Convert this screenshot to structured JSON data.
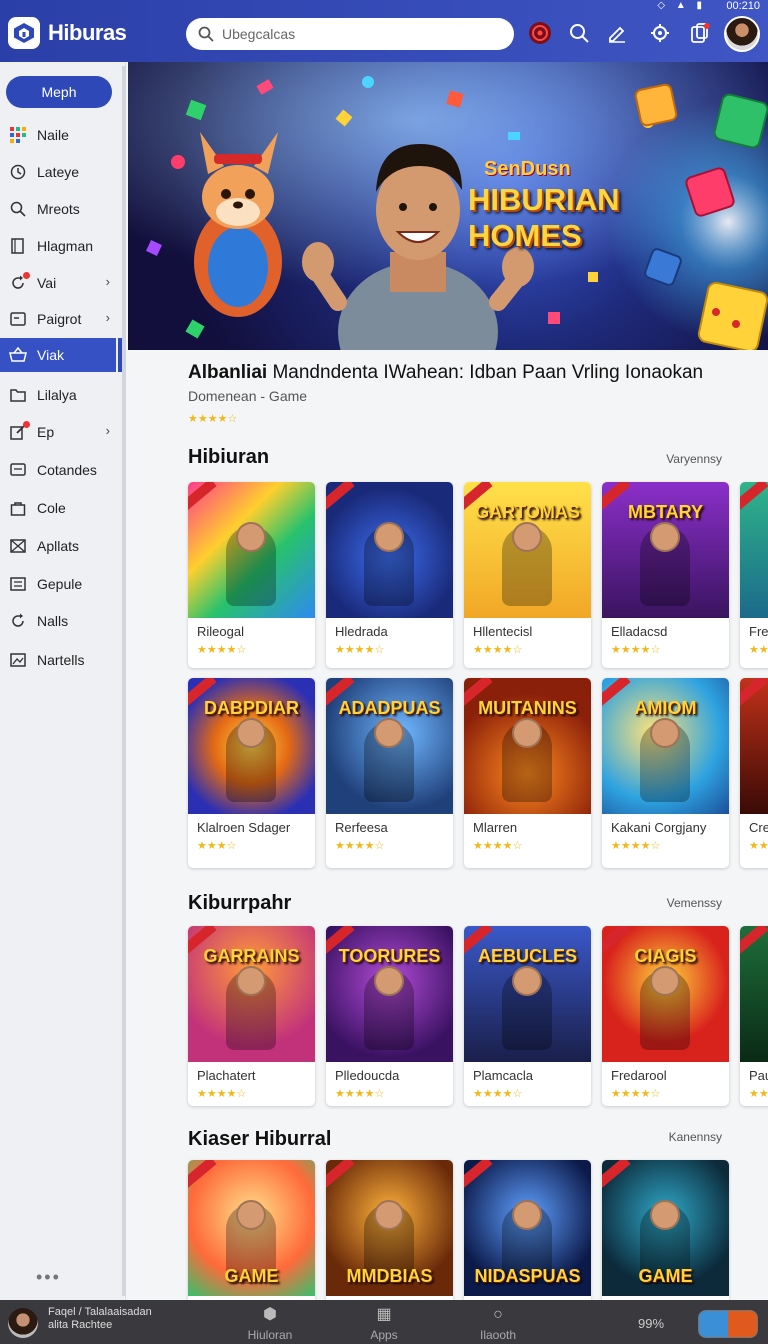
{
  "status": {
    "time": "00:210",
    "icons": "◇ ▲ ▮"
  },
  "header": {
    "app_title": "Hiburas",
    "search_placeholder": "Ubegcalcas"
  },
  "sidebar": {
    "primary_button": "Meph",
    "items": [
      {
        "label": "Naile",
        "icon": "grid-icon",
        "chevron": false,
        "badge": false
      },
      {
        "label": "Lateye",
        "icon": "clock-icon",
        "chevron": false,
        "badge": false
      },
      {
        "label": "Mreots",
        "icon": "search-icon",
        "chevron": false,
        "badge": false
      },
      {
        "label": "Hlagman",
        "icon": "book-icon",
        "chevron": false,
        "badge": false
      },
      {
        "label": "Vai",
        "icon": "refresh-icon",
        "chevron": true,
        "badge": true
      },
      {
        "label": "Paigrot",
        "icon": "card-icon",
        "chevron": true,
        "badge": false
      },
      {
        "label": "Viak",
        "icon": "basket-icon",
        "chevron": false,
        "badge": false,
        "active": true
      },
      {
        "label": "Lilalya",
        "icon": "folder-icon",
        "chevron": false,
        "badge": false
      },
      {
        "label": "Ep",
        "icon": "edit-icon",
        "chevron": true,
        "badge": true
      },
      {
        "label": "Cotandes",
        "icon": "message-icon",
        "chevron": false,
        "badge": false
      },
      {
        "label": "Cole",
        "icon": "bag-icon",
        "chevron": false,
        "badge": false
      },
      {
        "label": "Apllats",
        "icon": "mail-icon",
        "chevron": false,
        "badge": false
      },
      {
        "label": "Gepule",
        "icon": "list-icon",
        "chevron": false,
        "badge": false
      },
      {
        "label": "Nalls",
        "icon": "refresh-icon",
        "chevron": false,
        "badge": false
      },
      {
        "label": "Nartells",
        "icon": "photo-icon",
        "chevron": false,
        "badge": false
      }
    ],
    "more": "•••"
  },
  "hero": {
    "kicker": "SenDusn",
    "title": "HIBURIAN HOMES"
  },
  "featured": {
    "title_bold": "Albanliai",
    "title_rest": "Mandndenta IWahean: Idban Paan Vrling Ionaokan",
    "subtitle": "Domenean - Game",
    "stars": "★★★★☆"
  },
  "sections": [
    {
      "title": "Hibiuran",
      "more": "Varyennsy"
    },
    {
      "title": "Kiburrpahr",
      "more": "Vemenssy"
    },
    {
      "title": "Kiaser Hiburral",
      "more": "Kanennsy"
    }
  ],
  "cards": {
    "row1": [
      {
        "name": "Rileogal",
        "art": "",
        "stars": "★★★★☆",
        "bg": "linear-gradient(135deg,#ff3d8a,#ffcf2e 35%,#27c26b 60%,#2f8af0)"
      },
      {
        "name": "Hledrada",
        "art": "",
        "stars": "★★★★☆",
        "bg": "radial-gradient(circle at 50% 55%,#3d6ef0,#1a2a7a 70%)"
      },
      {
        "name": "Hllentecisl",
        "art": "GARTOMAS",
        "stars": "★★★★☆",
        "bg": "linear-gradient(180deg,#ffe14a,#f1a726)"
      },
      {
        "name": "Elladacsd",
        "art": "MBTARY",
        "stars": "★★★★☆",
        "bg": "linear-gradient(180deg,#8b2fc9,#3a1460)"
      },
      {
        "name": "Fre",
        "art": "",
        "stars": "★★★★",
        "bg": "linear-gradient(180deg,#2fb48a,#1b6a8a)"
      }
    ],
    "row2": [
      {
        "name": "Klalroen Sdager",
        "art": "DABPDIAR",
        "stars": "★★★☆",
        "bg": "radial-gradient(circle,#ffd24a,#e46a14 40%,#2b2fb4 80%)"
      },
      {
        "name": "Rerfeesa",
        "art": "ADADPUAS",
        "stars": "★★★★☆",
        "bg": "radial-gradient(circle at 60% 40%,#6fb6ff,#20407a 70%)"
      },
      {
        "name": "Mlarren",
        "art": "MUITANINS",
        "stars": "★★★★☆",
        "bg": "radial-gradient(circle at 50% 70%,#ff8a1e,#8a1f0a 70%)"
      },
      {
        "name": "Kakani Corgjany",
        "art": "AMIOM",
        "stars": "★★★★☆",
        "bg": "radial-gradient(circle at 40% 40%,#ffe27a,#2ea3e0 60%,#1c4f9a)"
      },
      {
        "name": "Cre",
        "art": "",
        "stars": "★★",
        "bg": "linear-gradient(180deg,#c2321a,#3a0a06)"
      }
    ],
    "row3": [
      {
        "name": "Plachatert",
        "art": "GARRAINS",
        "stars": "★★★★☆",
        "bg": "radial-gradient(circle at 50% 30%,#ff9a3a,#c2327a 70%)"
      },
      {
        "name": "Plledoucda",
        "art": "TOORURES",
        "stars": "★★★★☆",
        "bg": "radial-gradient(circle at 50% 40%,#b24ad6,#3a1262 75%)"
      },
      {
        "name": "Plamcacla",
        "art": "AEBUCLES",
        "stars": "★★★★☆",
        "bg": "linear-gradient(180deg,#3a58c8,#1a1f4a)"
      },
      {
        "name": "Fredarool",
        "art": "CIAGIS",
        "stars": "★★★★☆",
        "bg": "radial-gradient(circle at 50% 40%,#ffd23a,#d8221c 60%)"
      },
      {
        "name": "Pau",
        "art": "",
        "stars": "★★",
        "bg": "linear-gradient(180deg,#1e6e3a,#0a2a16)"
      }
    ],
    "row4": [
      {
        "name": "",
        "art": "GAME",
        "stars": "",
        "bg": "radial-gradient(circle at 50% 40%,#ffe08a,#ff6a3a 60%,#32c26e)"
      },
      {
        "name": "",
        "art": "MMDBIAS",
        "stars": "",
        "bg": "radial-gradient(circle at 50% 40%,#ffb23a,#6a2a0a 70%)"
      },
      {
        "name": "",
        "art": "NIDASPUAS",
        "stars": "",
        "bg": "radial-gradient(circle at 50% 40%,#5fa0ff,#0c1a4a 70%)"
      },
      {
        "name": "",
        "art": "GAME",
        "stars": "",
        "bg": "radial-gradient(circle at 50% 40%,#2fa8c8,#0c2a3a 70%)"
      }
    ]
  },
  "bottombar": {
    "user_line1": "Faqel / Talalaaisadan",
    "user_line2": "alita Rachtee",
    "tabs": [
      {
        "label": "Hiuloran",
        "icon": "⬢"
      },
      {
        "label": "Apps",
        "icon": "▦"
      },
      {
        "label": "Ilaooth",
        "icon": "○"
      }
    ],
    "battery": "99%"
  }
}
